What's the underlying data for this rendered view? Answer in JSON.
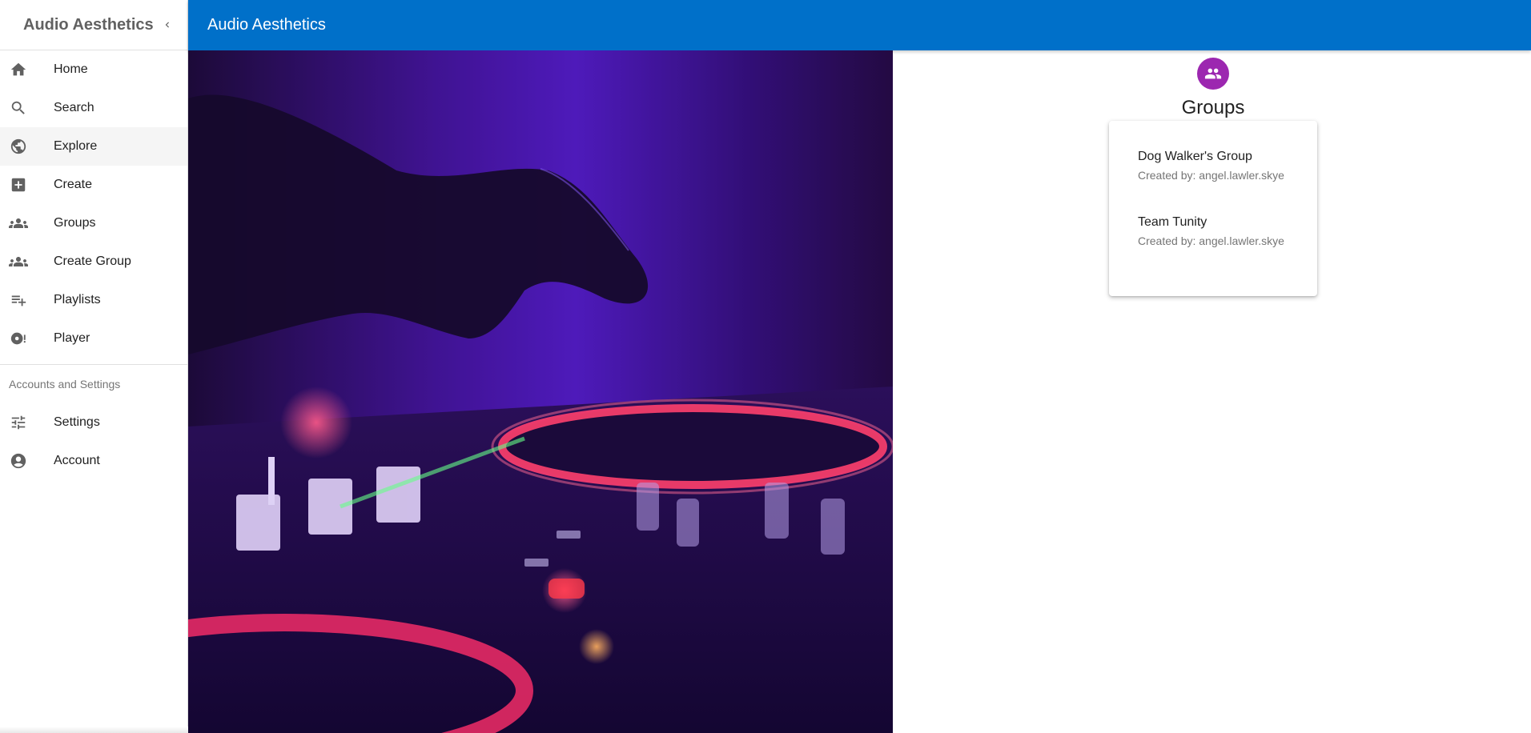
{
  "app": {
    "title": "Audio Aesthetics",
    "bar_title": "Audio Aesthetics"
  },
  "sidebar": {
    "items": [
      {
        "label": "Home",
        "icon": "home-icon"
      },
      {
        "label": "Search",
        "icon": "search-icon"
      },
      {
        "label": "Explore",
        "icon": "globe-icon"
      },
      {
        "label": "Create",
        "icon": "add-box-icon"
      },
      {
        "label": "Groups",
        "icon": "groups-icon"
      },
      {
        "label": "Create Group",
        "icon": "groups-icon"
      },
      {
        "label": "Playlists",
        "icon": "playlist-add-icon"
      },
      {
        "label": "Player",
        "icon": "player-icon"
      }
    ],
    "settings_header": "Accounts and Settings",
    "settings_items": [
      {
        "label": "Settings",
        "icon": "tune-icon"
      },
      {
        "label": "Account",
        "icon": "account-circle-icon"
      }
    ]
  },
  "groups": {
    "heading": "Groups",
    "items": [
      {
        "name": "Dog Walker's Group",
        "created_by": "Created by: angel.lawler.skye"
      },
      {
        "name": "Team Tunity",
        "created_by": "Created by: angel.lawler.skye"
      }
    ]
  },
  "colors": {
    "app_bar": "#0070c9",
    "avatar": "#9c27b0",
    "active_nav_bg": "#f5f5f5"
  }
}
